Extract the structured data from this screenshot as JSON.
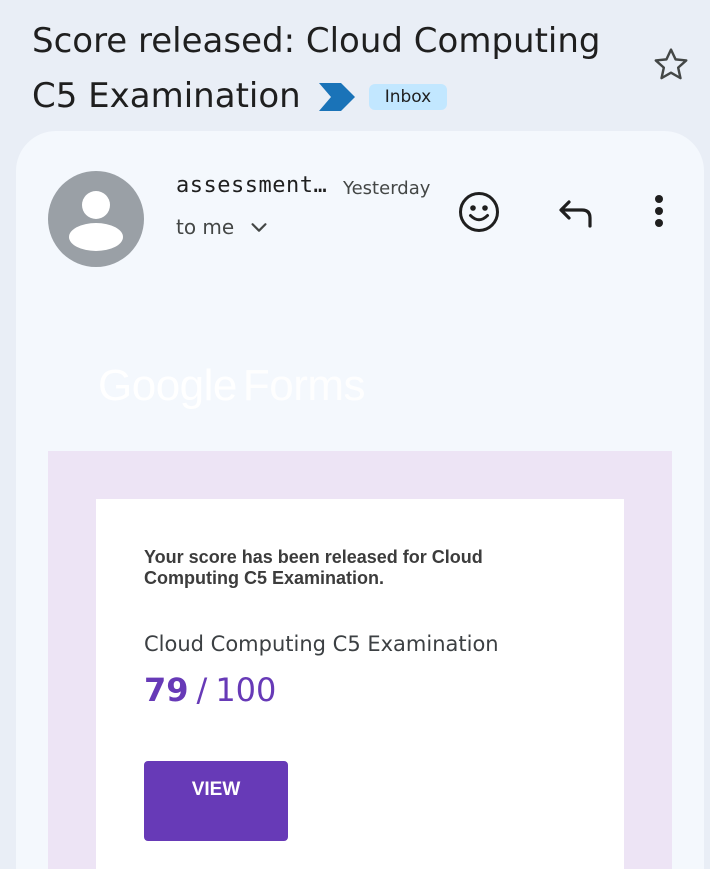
{
  "subject": {
    "line1": "Score released: Cloud Computing",
    "line2": "C5 Examination",
    "label": "Inbox",
    "importance_color": "#1a73b8",
    "star_icon": "star-outline-icon"
  },
  "message": {
    "sender": "assessment…",
    "timestamp": "Yesterday",
    "recipient": "to me",
    "icons": [
      "avatar-person-icon",
      "emoji-icon",
      "reply-icon",
      "more-vert-icon",
      "chevron-down-icon"
    ]
  },
  "branding": {
    "google": "Google",
    "forms": "Forms"
  },
  "body": {
    "notice": "Your score has been released for Cloud Computing C5 Examination.",
    "exam_name": "Cloud Computing C5 Examination",
    "score": "79",
    "separator": "/",
    "total": "100",
    "view_label": "VIEW",
    "accent_color": "#673ab7",
    "frame_color": "#ede4f5"
  }
}
